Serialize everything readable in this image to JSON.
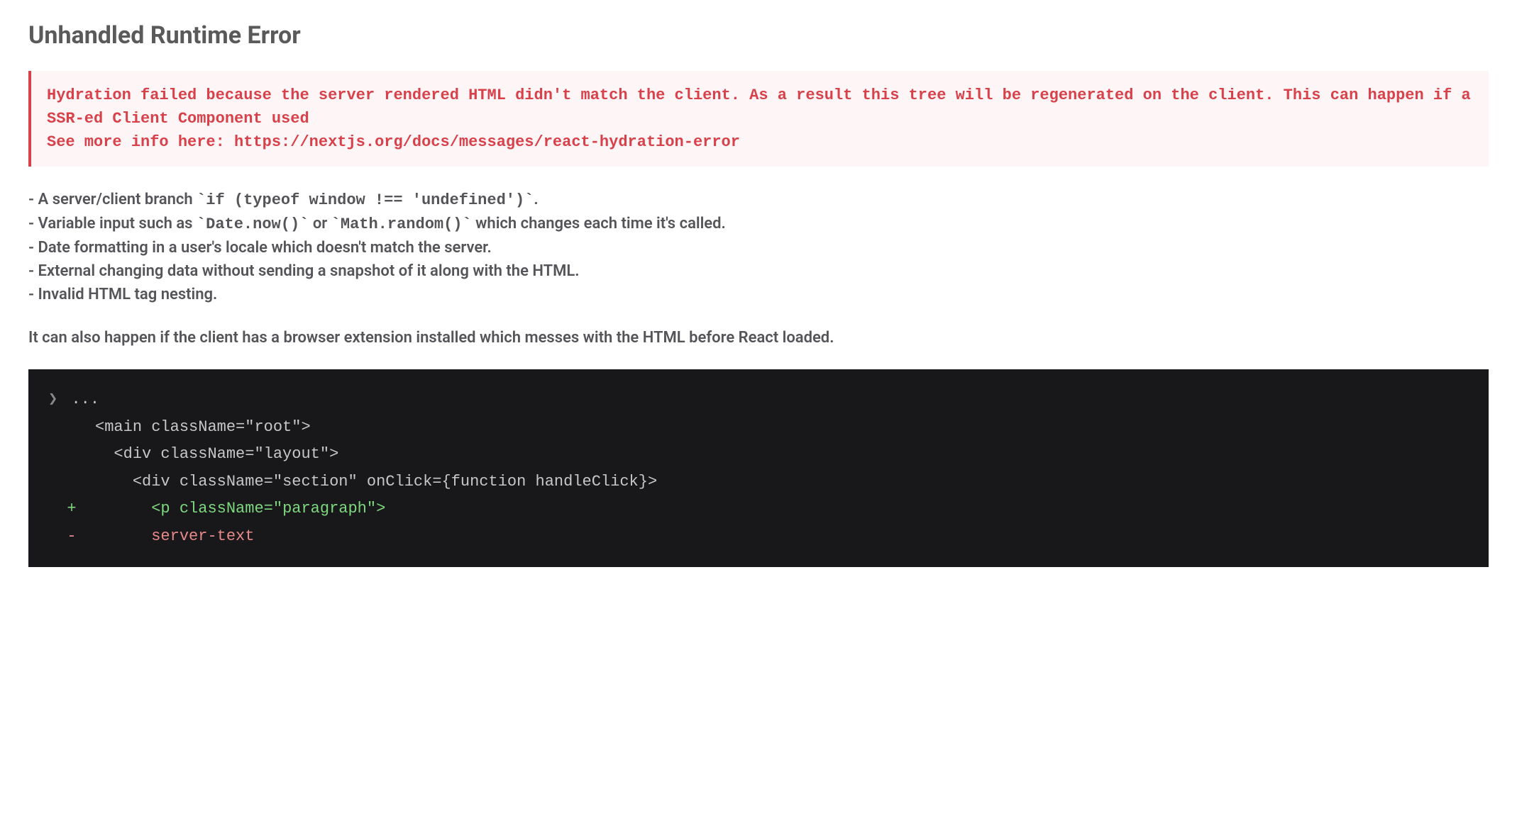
{
  "title": "Unhandled Runtime Error",
  "error_message": "Hydration failed because the server rendered HTML didn't match the client. As a result this tree will be regenerated on the client. This can happen if a SSR-ed Client Component used\nSee more info here: https://nextjs.org/docs/messages/react-hydration-error",
  "causes": [
    "- A server/client branch `if (typeof window !== 'undefined')`.",
    "- Variable input such as `Date.now()` or `Math.random()` which changes each time it's called.",
    "- Date formatting in a user's locale which doesn't match the server.",
    "- External changing data without sending a snapshot of it along with the HTML.",
    "- Invalid HTML tag nesting."
  ],
  "additional_note": "It can also happen if the client has a browser extension installed which messes with the HTML before React loaded.",
  "code_diff": {
    "chevron": "❯",
    "lines": [
      {
        "indent": "",
        "prefix": "",
        "text": "...",
        "cls": "code-gray",
        "first": true
      },
      {
        "indent": "  ",
        "prefix": "",
        "text": "<main className=\"root\">",
        "cls": "code-gray"
      },
      {
        "indent": "    ",
        "prefix": "",
        "text": "<div className=\"layout\">",
        "cls": "code-gray"
      },
      {
        "indent": "      ",
        "prefix": "",
        "text": "<div className=\"section\" onClick={function handleClick}>",
        "cls": "code-gray"
      },
      {
        "indent": "        ",
        "prefix": "+",
        "text": "<p className=\"paragraph\">",
        "cls": "code-green"
      },
      {
        "indent": "        ",
        "prefix": "-",
        "text": "server-text",
        "cls": "code-red"
      }
    ]
  }
}
